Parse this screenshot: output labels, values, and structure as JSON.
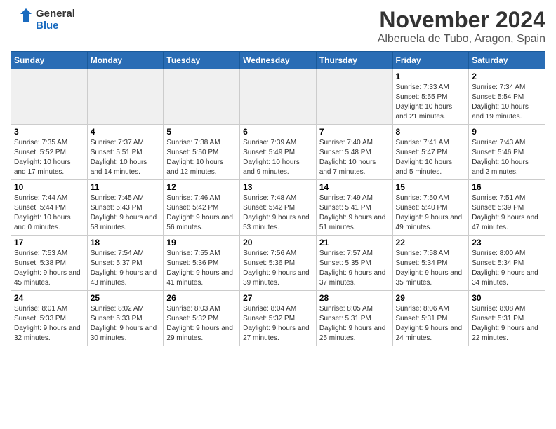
{
  "logo": {
    "general": "General",
    "blue": "Blue"
  },
  "title": "November 2024",
  "location": "Alberuela de Tubo, Aragon, Spain",
  "weekdays": [
    "Sunday",
    "Monday",
    "Tuesday",
    "Wednesday",
    "Thursday",
    "Friday",
    "Saturday"
  ],
  "weeks": [
    [
      {
        "day": "",
        "empty": true
      },
      {
        "day": "",
        "empty": true
      },
      {
        "day": "",
        "empty": true
      },
      {
        "day": "",
        "empty": true
      },
      {
        "day": "",
        "empty": true
      },
      {
        "day": "1",
        "info": "Sunrise: 7:33 AM\nSunset: 5:55 PM\nDaylight: 10 hours and 21 minutes."
      },
      {
        "day": "2",
        "info": "Sunrise: 7:34 AM\nSunset: 5:54 PM\nDaylight: 10 hours and 19 minutes."
      }
    ],
    [
      {
        "day": "3",
        "info": "Sunrise: 7:35 AM\nSunset: 5:52 PM\nDaylight: 10 hours and 17 minutes."
      },
      {
        "day": "4",
        "info": "Sunrise: 7:37 AM\nSunset: 5:51 PM\nDaylight: 10 hours and 14 minutes."
      },
      {
        "day": "5",
        "info": "Sunrise: 7:38 AM\nSunset: 5:50 PM\nDaylight: 10 hours and 12 minutes."
      },
      {
        "day": "6",
        "info": "Sunrise: 7:39 AM\nSunset: 5:49 PM\nDaylight: 10 hours and 9 minutes."
      },
      {
        "day": "7",
        "info": "Sunrise: 7:40 AM\nSunset: 5:48 PM\nDaylight: 10 hours and 7 minutes."
      },
      {
        "day": "8",
        "info": "Sunrise: 7:41 AM\nSunset: 5:47 PM\nDaylight: 10 hours and 5 minutes."
      },
      {
        "day": "9",
        "info": "Sunrise: 7:43 AM\nSunset: 5:46 PM\nDaylight: 10 hours and 2 minutes."
      }
    ],
    [
      {
        "day": "10",
        "info": "Sunrise: 7:44 AM\nSunset: 5:44 PM\nDaylight: 10 hours and 0 minutes."
      },
      {
        "day": "11",
        "info": "Sunrise: 7:45 AM\nSunset: 5:43 PM\nDaylight: 9 hours and 58 minutes."
      },
      {
        "day": "12",
        "info": "Sunrise: 7:46 AM\nSunset: 5:42 PM\nDaylight: 9 hours and 56 minutes."
      },
      {
        "day": "13",
        "info": "Sunrise: 7:48 AM\nSunset: 5:42 PM\nDaylight: 9 hours and 53 minutes."
      },
      {
        "day": "14",
        "info": "Sunrise: 7:49 AM\nSunset: 5:41 PM\nDaylight: 9 hours and 51 minutes."
      },
      {
        "day": "15",
        "info": "Sunrise: 7:50 AM\nSunset: 5:40 PM\nDaylight: 9 hours and 49 minutes."
      },
      {
        "day": "16",
        "info": "Sunrise: 7:51 AM\nSunset: 5:39 PM\nDaylight: 9 hours and 47 minutes."
      }
    ],
    [
      {
        "day": "17",
        "info": "Sunrise: 7:53 AM\nSunset: 5:38 PM\nDaylight: 9 hours and 45 minutes."
      },
      {
        "day": "18",
        "info": "Sunrise: 7:54 AM\nSunset: 5:37 PM\nDaylight: 9 hours and 43 minutes."
      },
      {
        "day": "19",
        "info": "Sunrise: 7:55 AM\nSunset: 5:36 PM\nDaylight: 9 hours and 41 minutes."
      },
      {
        "day": "20",
        "info": "Sunrise: 7:56 AM\nSunset: 5:36 PM\nDaylight: 9 hours and 39 minutes."
      },
      {
        "day": "21",
        "info": "Sunrise: 7:57 AM\nSunset: 5:35 PM\nDaylight: 9 hours and 37 minutes."
      },
      {
        "day": "22",
        "info": "Sunrise: 7:58 AM\nSunset: 5:34 PM\nDaylight: 9 hours and 35 minutes."
      },
      {
        "day": "23",
        "info": "Sunrise: 8:00 AM\nSunset: 5:34 PM\nDaylight: 9 hours and 34 minutes."
      }
    ],
    [
      {
        "day": "24",
        "info": "Sunrise: 8:01 AM\nSunset: 5:33 PM\nDaylight: 9 hours and 32 minutes."
      },
      {
        "day": "25",
        "info": "Sunrise: 8:02 AM\nSunset: 5:33 PM\nDaylight: 9 hours and 30 minutes."
      },
      {
        "day": "26",
        "info": "Sunrise: 8:03 AM\nSunset: 5:32 PM\nDaylight: 9 hours and 29 minutes."
      },
      {
        "day": "27",
        "info": "Sunrise: 8:04 AM\nSunset: 5:32 PM\nDaylight: 9 hours and 27 minutes."
      },
      {
        "day": "28",
        "info": "Sunrise: 8:05 AM\nSunset: 5:31 PM\nDaylight: 9 hours and 25 minutes."
      },
      {
        "day": "29",
        "info": "Sunrise: 8:06 AM\nSunset: 5:31 PM\nDaylight: 9 hours and 24 minutes."
      },
      {
        "day": "30",
        "info": "Sunrise: 8:08 AM\nSunset: 5:31 PM\nDaylight: 9 hours and 22 minutes."
      }
    ]
  ]
}
